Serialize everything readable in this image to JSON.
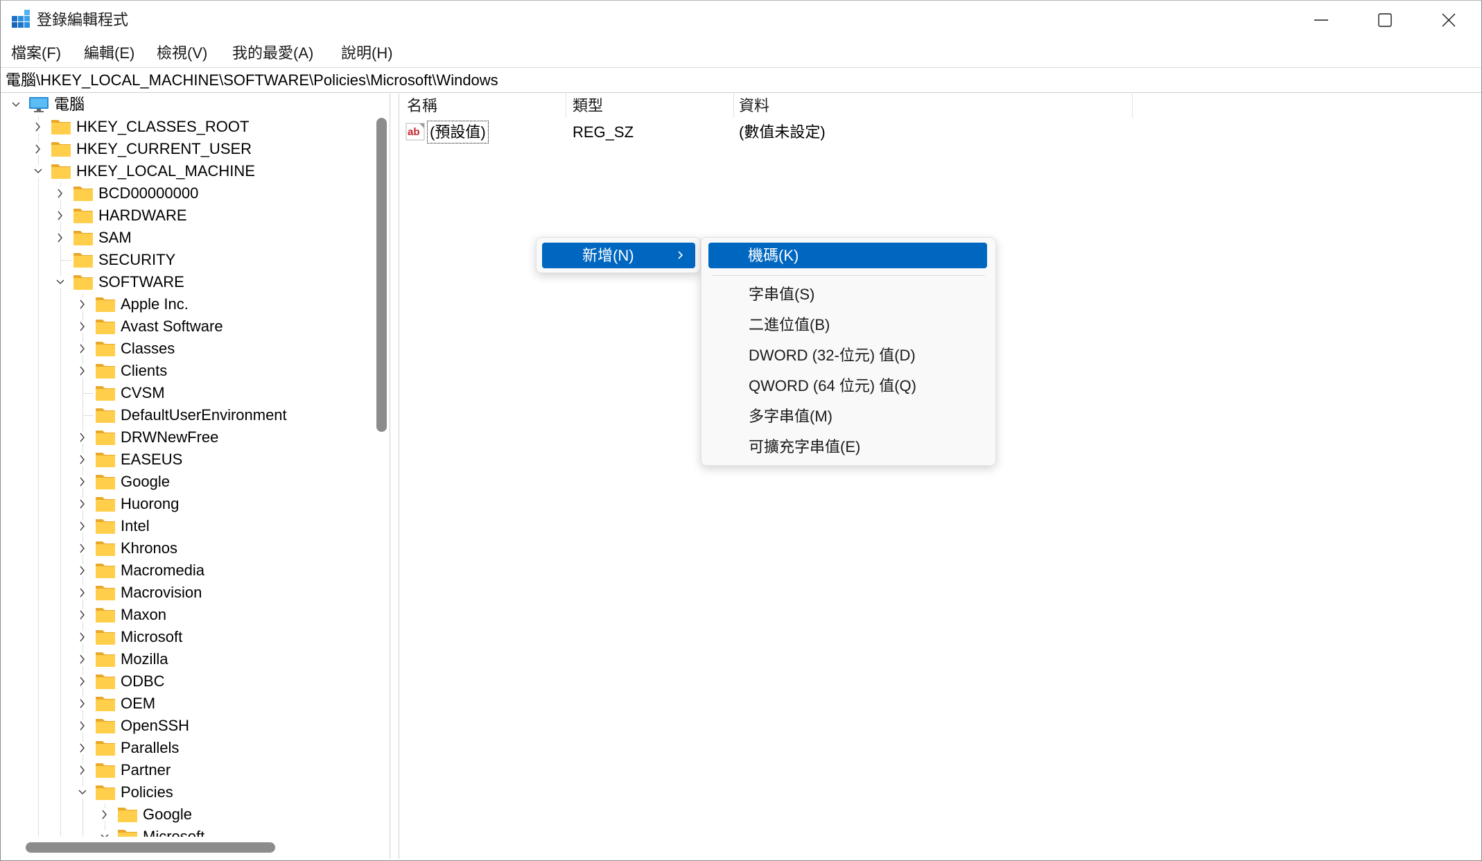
{
  "window": {
    "title": "登錄編輯程式",
    "app_icon": "registry-editor-icon",
    "controls": [
      "minimize-icon",
      "maximize-icon",
      "close-icon"
    ]
  },
  "menu_bar": {
    "items": [
      {
        "label": "檔案(F)"
      },
      {
        "label": "編輯(E)"
      },
      {
        "label": "檢視(V)"
      },
      {
        "label": "我的最愛(A)"
      },
      {
        "label": "說明(H)"
      }
    ]
  },
  "address_bar": {
    "path": "電腦\\HKEY_LOCAL_MACHINE\\SOFTWARE\\Policies\\Microsoft\\Windows"
  },
  "tree": {
    "root": {
      "label": "電腦",
      "icon": "computer-icon",
      "has_children": true,
      "expanded": true,
      "children": [
        {
          "label": "HKEY_CLASSES_ROOT",
          "has_children": true,
          "expanded": false
        },
        {
          "label": "HKEY_CURRENT_USER",
          "has_children": true,
          "expanded": false
        },
        {
          "label": "HKEY_LOCAL_MACHINE",
          "has_children": true,
          "expanded": true,
          "children": [
            {
              "label": "BCD00000000",
              "has_children": true,
              "expanded": false
            },
            {
              "label": "HARDWARE",
              "has_children": true,
              "expanded": false
            },
            {
              "label": "SAM",
              "has_children": true,
              "expanded": false
            },
            {
              "label": "SECURITY",
              "has_children": false
            },
            {
              "label": "SOFTWARE",
              "has_children": true,
              "expanded": true,
              "children": [
                {
                  "label": "Apple Inc.",
                  "has_children": true,
                  "expanded": false
                },
                {
                  "label": "Avast Software",
                  "has_children": true,
                  "expanded": false
                },
                {
                  "label": "Classes",
                  "has_children": true,
                  "expanded": false
                },
                {
                  "label": "Clients",
                  "has_children": true,
                  "expanded": false
                },
                {
                  "label": "CVSM",
                  "has_children": false
                },
                {
                  "label": "DefaultUserEnvironment",
                  "has_children": false
                },
                {
                  "label": "DRWNewFree",
                  "has_children": true,
                  "expanded": false
                },
                {
                  "label": "EASEUS",
                  "has_children": true,
                  "expanded": false
                },
                {
                  "label": "Google",
                  "has_children": true,
                  "expanded": false
                },
                {
                  "label": "Huorong",
                  "has_children": true,
                  "expanded": false
                },
                {
                  "label": "Intel",
                  "has_children": true,
                  "expanded": false
                },
                {
                  "label": "Khronos",
                  "has_children": true,
                  "expanded": false
                },
                {
                  "label": "Macromedia",
                  "has_children": true,
                  "expanded": false
                },
                {
                  "label": "Macrovision",
                  "has_children": true,
                  "expanded": false
                },
                {
                  "label": "Maxon",
                  "has_children": true,
                  "expanded": false
                },
                {
                  "label": "Microsoft",
                  "has_children": true,
                  "expanded": false
                },
                {
                  "label": "Mozilla",
                  "has_children": true,
                  "expanded": false
                },
                {
                  "label": "ODBC",
                  "has_children": true,
                  "expanded": false
                },
                {
                  "label": "OEM",
                  "has_children": true,
                  "expanded": false
                },
                {
                  "label": "OpenSSH",
                  "has_children": true,
                  "expanded": false
                },
                {
                  "label": "Parallels",
                  "has_children": true,
                  "expanded": false
                },
                {
                  "label": "Partner",
                  "has_children": true,
                  "expanded": false
                },
                {
                  "label": "Policies",
                  "has_children": true,
                  "expanded": true,
                  "children": [
                    {
                      "label": "Google",
                      "has_children": true,
                      "expanded": false
                    },
                    {
                      "label": "Microsoft",
                      "has_children": true,
                      "expanded": true
                    }
                  ]
                }
              ]
            }
          ]
        }
      ]
    }
  },
  "values_pane": {
    "columns": [
      {
        "label": "名稱"
      },
      {
        "label": "類型"
      },
      {
        "label": "資料"
      }
    ],
    "rows": [
      {
        "icon": "string-value-icon",
        "icon_text": "ab",
        "name": "(預設值)",
        "type": "REG_SZ",
        "data": "(數值未設定)",
        "focused": true
      }
    ]
  },
  "context_menu": {
    "items": [
      {
        "label": "新增(N)",
        "highlighted": true,
        "has_submenu": true,
        "submenu": {
          "items": [
            {
              "label": "機碼(K)",
              "highlighted": true
            },
            {
              "type": "separator"
            },
            {
              "label": "字串值(S)"
            },
            {
              "label": "二進位值(B)"
            },
            {
              "label": "DWORD (32-位元) 值(D)"
            },
            {
              "label": "QWORD (64 位元) 值(Q)"
            },
            {
              "label": "多字串值(M)"
            },
            {
              "label": "可擴充字串值(E)"
            }
          ]
        }
      }
    ]
  },
  "colors": {
    "accent": "#0067C0",
    "menu_background": "#F9F9F9",
    "folder": "#FFCE4A",
    "folder_tab": "#E9A82A",
    "computer": "#2A8BD8",
    "scrollbar_thumb": "#8C8C8C",
    "string_icon_text": "#C4262E"
  }
}
